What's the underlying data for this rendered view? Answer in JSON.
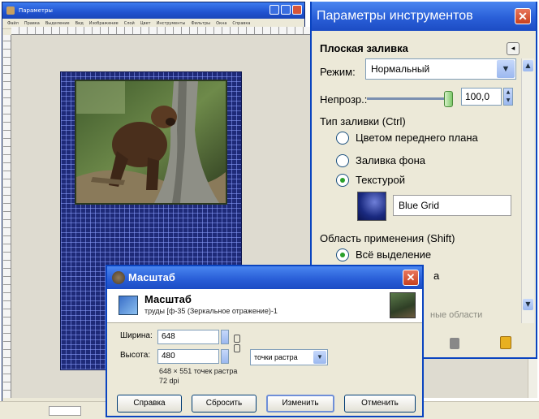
{
  "gimp_window": {
    "title": "Параметры",
    "menu": [
      "Файл",
      "Правка",
      "Выделение",
      "Вид",
      "Изображение",
      "Слой",
      "Цвет",
      "Инструменты",
      "Фильтры",
      "Окна",
      "Справка"
    ]
  },
  "tool_options": {
    "title": "Параметры инструментов",
    "close_glyph": "✕",
    "heading": "Плоская заливка",
    "mode_label": "Режим:",
    "mode_value": "Нормальный",
    "opacity_label": "Непрозр.:",
    "opacity_value": "100,0",
    "opacity_fraction": 1.0,
    "fill_type_label": "Тип заливки  (Ctrl)",
    "fill_options": [
      {
        "label": "Цветом переднего плана",
        "checked": false
      },
      {
        "label": "Заливка фона",
        "checked": false
      },
      {
        "label": "Текстурой",
        "checked": true
      }
    ],
    "pattern_name": "Blue Grid",
    "area_label": "Область применения  (Shift)",
    "area_options": [
      {
        "label": "Всё выделение",
        "checked": true
      },
      {
        "label": "а",
        "checked": false
      }
    ],
    "partial_text": "ные области"
  },
  "scale_dialog": {
    "title": "Масштаб",
    "heading": "Масштаб",
    "subheading": "труды [ф-35 (Зеркальное отражение)-1",
    "width_label": "Ширина:",
    "width_value": "648",
    "height_label": "Высота:",
    "height_value": "480",
    "units": "точки растра",
    "info_size": "648 × 551 точек растра",
    "info_dpi": "72 dpi",
    "buttons": {
      "help": "Справка",
      "reset": "Сбросить",
      "scale": "Изменить",
      "cancel": "Отменить"
    }
  }
}
